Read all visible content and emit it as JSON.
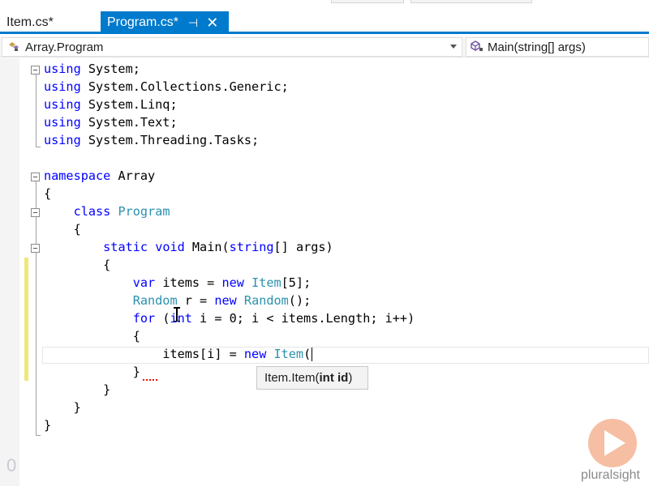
{
  "tabs": [
    {
      "label": "Item.cs*",
      "active": false
    },
    {
      "label": "Program.cs*",
      "active": true,
      "pin_glyph": "⊣",
      "close_glyph": "✕"
    }
  ],
  "navbar": {
    "left": {
      "icon": "class-icon",
      "text": "Array.Program"
    },
    "right": {
      "icon": "method-icon",
      "text": "Main(string[] args)"
    }
  },
  "code": {
    "l1": {
      "kw": "using",
      "rest": " System;"
    },
    "l2": {
      "kw": "using",
      "rest": " System.Collections.Generic;"
    },
    "l3": {
      "kw": "using",
      "rest": " System.Linq;"
    },
    "l4": {
      "kw": "using",
      "rest": " System.Text;"
    },
    "l5": {
      "kw": "using",
      "rest": " System.Threading.Tasks;"
    },
    "l7": {
      "kw": "namespace",
      "rest": " Array"
    },
    "l8": {
      "text": "{"
    },
    "l9": {
      "indent": "    ",
      "kw": "class",
      "type": "Program"
    },
    "l10": {
      "indent": "    ",
      "text": "{"
    },
    "l11": {
      "indent": "        ",
      "kw1": "static",
      "kw2": "void",
      "name": " Main(",
      "kw3": "string",
      "rest": "[] args)"
    },
    "l12": {
      "indent": "        ",
      "text": "{"
    },
    "l13": {
      "indent": "            ",
      "kw": "var",
      "mid": " items = ",
      "kw2": "new",
      "type": "Item",
      "rest": "[5];"
    },
    "l14": {
      "indent": "            ",
      "type": "Random",
      "mid": " r = ",
      "kw": "new",
      "type2": "Random",
      "rest": "();"
    },
    "l15": {
      "indent": "            ",
      "kw": "for",
      "mid": " (",
      "kw2": "int",
      "rest": " i = 0; i < items.Length; i++)"
    },
    "l16": {
      "indent": "            ",
      "text": "{"
    },
    "l17": {
      "indent": "                ",
      "mid": "items[i] = ",
      "kw": "new",
      "type": "Item",
      "rest": "("
    },
    "l18": {
      "indent": "            ",
      "text": "}"
    },
    "l19": {
      "indent": "        ",
      "text": "}"
    },
    "l20": {
      "indent": "    ",
      "text": "}"
    },
    "l21": {
      "text": "}"
    }
  },
  "tooltip": {
    "prefix": "Item.Item(",
    "param": "int id",
    "suffix": ")"
  },
  "watermark": {
    "brand": "pluralsight",
    "corner_digit": "0",
    "accent": "#f6b79a"
  },
  "colors": {
    "keyword": "#0000ff",
    "type": "#2b91af",
    "accent": "#007acc"
  }
}
